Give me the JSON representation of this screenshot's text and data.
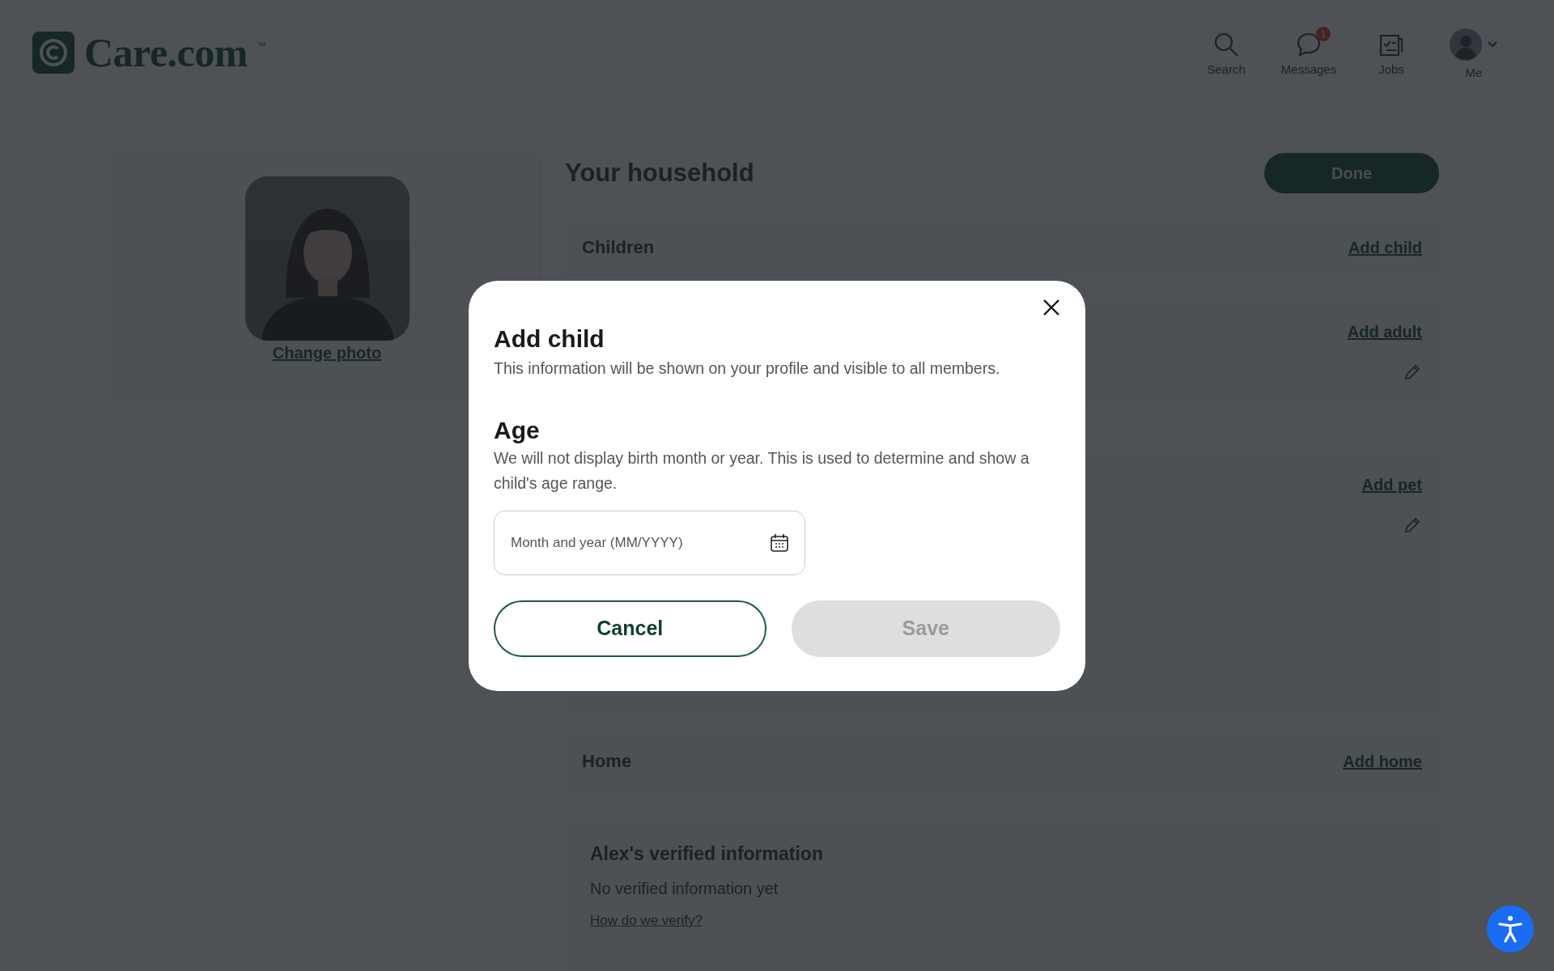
{
  "header": {
    "logo_text": "Care.com",
    "logo_mark": "™",
    "nav": [
      {
        "label": "Search",
        "kind": "search"
      },
      {
        "label": "Messages",
        "kind": "messages",
        "badge": "1"
      },
      {
        "label": "Jobs",
        "kind": "jobs"
      },
      {
        "label": "Me",
        "kind": "avatar"
      }
    ]
  },
  "profile": {
    "change_photo": "Change photo"
  },
  "household": {
    "title": "Your household",
    "done_button": "Done",
    "sections": [
      {
        "title": "Children",
        "action": "Add child",
        "editable": false
      },
      {
        "action": "Add adult",
        "editable": true
      },
      {
        "action": "Add pet",
        "editable": true
      },
      {
        "title": "Home",
        "action": "Add home",
        "editable": false
      }
    ]
  },
  "verified": {
    "title": "Alex's verified information",
    "status": "No verified information yet",
    "link": "How do we verify?"
  },
  "modal": {
    "title": "Add child",
    "description": "This information will be shown on your profile and visible to all members.",
    "age_heading": "Age",
    "age_description": "We will not display birth month or year. This is used to determine and show a child's age range.",
    "date_field": {
      "placeholder": "Month and year (MM/YYYY)"
    },
    "buttons": [
      {
        "label": "Cancel",
        "kind": "secondary",
        "disabled": false
      },
      {
        "label": "Save",
        "kind": "primary",
        "disabled": true
      }
    ]
  }
}
